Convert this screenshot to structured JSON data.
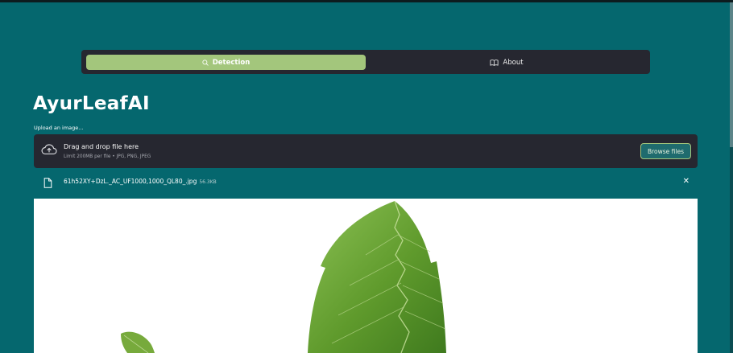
{
  "tabs": [
    {
      "label": "Detection",
      "icon": "search-icon",
      "active": true
    },
    {
      "label": "About",
      "icon": "book-icon",
      "active": false
    }
  ],
  "app": {
    "title": "AyurLeafAI"
  },
  "uploader": {
    "label": "Upload an image...",
    "drop_title": "Drag and drop file here",
    "drop_subtitle": "Limit 200MB per file • JPG, PNG, JPEG",
    "browse_label": "Browse files",
    "icon": "cloud-upload-icon"
  },
  "file": {
    "name": "61h52XY+DzL._AC_UF1000,1000_QL80_.jpg",
    "size": "56.3KB",
    "icon": "file-icon",
    "close_icon": "close-icon"
  },
  "colors": {
    "background": "#05676e",
    "active_tab": "#a3c67c",
    "panel": "#262730",
    "leaf": "#5f9a2c"
  }
}
